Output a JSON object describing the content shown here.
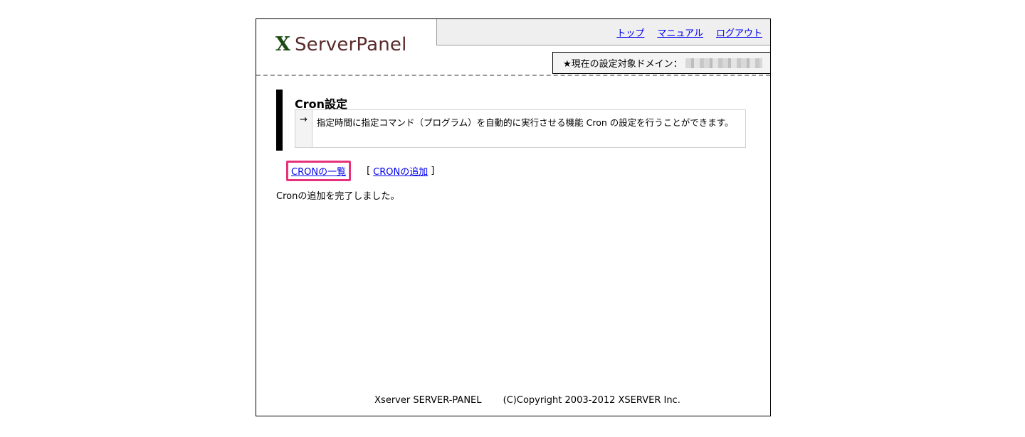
{
  "logo": {
    "mark": "X",
    "text": "ServerPanel"
  },
  "nav": {
    "top": "トップ",
    "manual": "マニュアル",
    "logout": "ログアウト"
  },
  "domain": {
    "label": "★現在の設定対象ドメイン：",
    "value_icon": "redacted-domain"
  },
  "section": {
    "title": "Cron設定",
    "arrow": "→",
    "description": "指定時間に指定コマンド（プログラム）を自動的に実行させる機能 Cron の設定を行うことができます。"
  },
  "links": {
    "list": "CRONの一覧",
    "bracket_open": "[",
    "add": "CRONの追加",
    "bracket_close": "]",
    "highlight_color": "#e6327a"
  },
  "message": "Cronの追加を完了しました。",
  "footer": {
    "product": "Xserver SERVER-PANEL",
    "copyright": "(C)Copyright 2003-2012 XSERVER Inc."
  }
}
